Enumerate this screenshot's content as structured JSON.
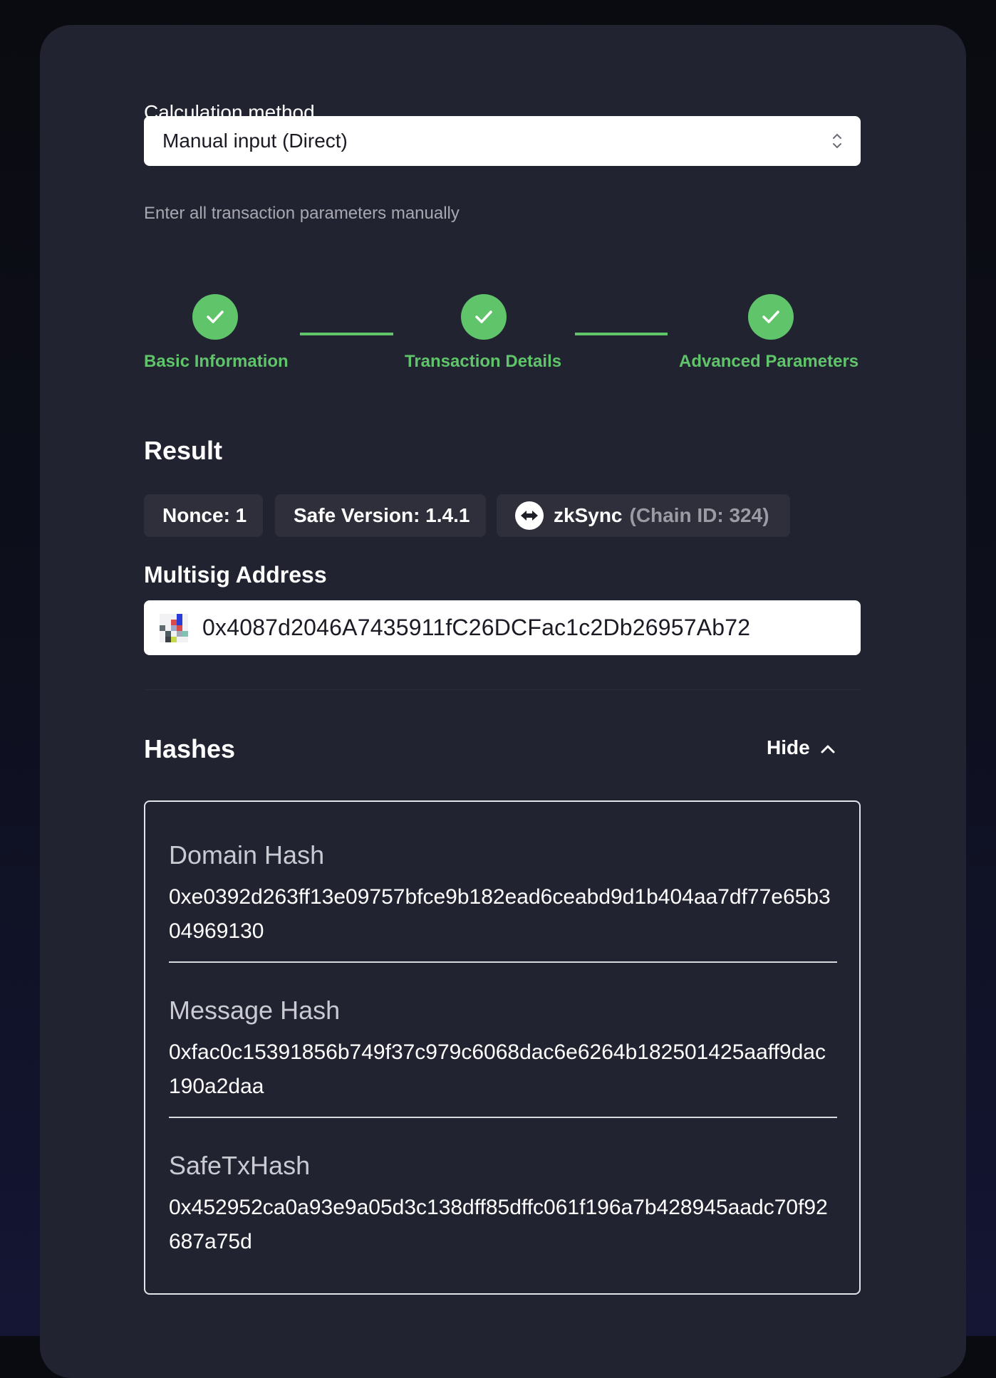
{
  "form": {
    "method_label": "Calculation method",
    "method_value": "Manual input (Direct)",
    "method_helper": "Enter all transaction parameters manually"
  },
  "steps": [
    {
      "label": "Basic Information",
      "status": "complete"
    },
    {
      "label": "Transaction Details",
      "status": "complete"
    },
    {
      "label": "Advanced Parameters",
      "status": "complete"
    }
  ],
  "result": {
    "title": "Result",
    "nonce": "Nonce: 1",
    "safe_version": "Safe Version: 1.4.1",
    "network_name": "zkSync",
    "chain_id": "(Chain ID: 324)",
    "multisig_label": "Multisig Address",
    "multisig_address": "0x4087d2046A7435911fC26DCFac1c2Db26957Ab72"
  },
  "hashes": {
    "title": "Hashes",
    "toggle_label": "Hide",
    "items": [
      {
        "title": "Domain Hash",
        "value": "0xe0392d263ff13e09757bfce9b182ead6ceabd9d1b404aa7df77e65b304969130"
      },
      {
        "title": "Message Hash",
        "value": "0xfac0c15391856b749f37c979c6068dac6e6264b182501425aaff9dac190a2daa"
      },
      {
        "title": "SafeTxHash",
        "value": "0x452952ca0a93e9a05d3c138dff85dffc061f196a7b428945aadc70f92687a75d"
      }
    ]
  },
  "colors": {
    "accent_green": "#5fc46a",
    "card_bg": "#222331",
    "badge_bg": "#2e2f3a"
  }
}
